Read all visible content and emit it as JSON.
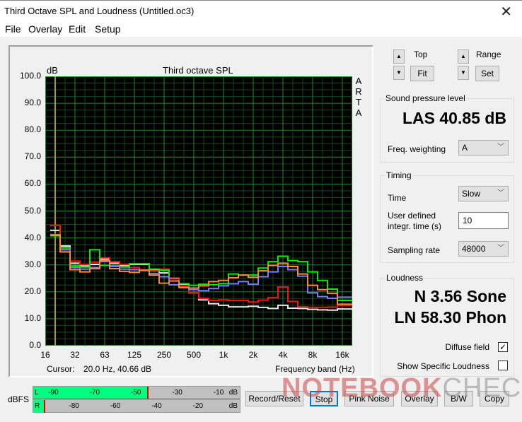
{
  "window": {
    "title": "Third Octave SPL and Loudness (Untitled.oc3)",
    "close_icon": "close-icon"
  },
  "menu": [
    "File",
    "Overlay",
    "Edit",
    "Setup"
  ],
  "plot_controls": {
    "top_label": "Top",
    "fit_label": "Fit",
    "range_label": "Range",
    "set_label": "Set",
    "up_icon": "▲",
    "down_icon": "▼"
  },
  "spl": {
    "group_label": "Sound pressure level",
    "value": "LAS 40.85 dB",
    "freq_weighting_label": "Freq. weighting",
    "freq_weighting_value": "A"
  },
  "timing": {
    "group_label": "Timing",
    "time_label": "Time",
    "time_value": "Slow",
    "integr_label_1": "User defined",
    "integr_label_2": "integr. time (s)",
    "integr_value": "10",
    "sampling_label": "Sampling rate",
    "sampling_value": "48000"
  },
  "loudness": {
    "group_label": "Loudness",
    "n_value": "N 3.56 Sone",
    "ln_value": "LN 58.30 Phon",
    "diffuse_label": "Diffuse field",
    "diffuse_checked": true,
    "specific_label": "Show Specific Loudness",
    "specific_checked": false,
    "check_glyph": "✓"
  },
  "cursor": {
    "label": "Cursor:",
    "value": "20.0 Hz, 40.66 dB"
  },
  "meter": {
    "label": "dBFS",
    "left_channel": "L",
    "right_channel": "R",
    "left_ticks": [
      "-90",
      "-70",
      "-50",
      "-30",
      "-10"
    ],
    "right_ticks": [
      "-80",
      "-60",
      "-40",
      "-20"
    ],
    "unit": "dB",
    "left_level_dbfs": -45,
    "right_level_dbfs": -95
  },
  "buttons": [
    "Record/Reset",
    "Stop",
    "Pink Noise",
    "Overlay",
    "B/W",
    "Copy"
  ],
  "watermark": {
    "text_a": "NOTEBOOK",
    "text_b": "CHECK"
  },
  "colors": {
    "plot_bg": "#000000",
    "grid_major": "#1f8a2a",
    "grid_minor": "#0e4a14",
    "cursor": "#a89a20",
    "meter_fill": "#00ff80",
    "meter_peak": "#e00000"
  },
  "chart_data": {
    "type": "line",
    "title": "Third octave SPL",
    "ylabel": "dB",
    "xlabel": "Frequency band (Hz)",
    "side_label": "ARTA",
    "ylim": [
      0,
      100
    ],
    "yticks": [
      "0.0",
      "10.0",
      "20.0",
      "30.0",
      "40.0",
      "50.0",
      "60.0",
      "70.0",
      "80.0",
      "90.0",
      "100.0"
    ],
    "xtick_labels": [
      "16",
      "32",
      "63",
      "125",
      "250",
      "500",
      "1k",
      "2k",
      "4k",
      "8k",
      "16k"
    ],
    "grid": true,
    "cursor_hz_band_index": 1,
    "bands": [
      "20",
      "25",
      "31.5",
      "40",
      "50",
      "63",
      "80",
      "100",
      "125",
      "160",
      "200",
      "250",
      "315",
      "400",
      "500",
      "630",
      "800",
      "1k",
      "1.25k",
      "1.6k",
      "2k",
      "2.5k",
      "3.15k",
      "4k",
      "5k",
      "6.3k",
      "8k",
      "10k",
      "12.5k",
      "16k",
      "20k"
    ],
    "series": [
      {
        "name": "white",
        "color": "#e8e8e8",
        "values": [
          42.8,
          37.0,
          30.6,
          29.6,
          30.2,
          32.2,
          30.6,
          29.8,
          30.2,
          30.2,
          28.2,
          27.0,
          25.0,
          22.8,
          19.6,
          17.0,
          15.6,
          15.0,
          14.4,
          14.4,
          14.6,
          14.2,
          13.8,
          15.0,
          13.9,
          13.8,
          13.5,
          13.3,
          13.2,
          13.6,
          13.6
        ]
      },
      {
        "name": "red",
        "color": "#ff1010",
        "values": [
          44.6,
          36.0,
          31.4,
          30.2,
          31.0,
          32.6,
          31.2,
          30.2,
          29.0,
          28.2,
          27.8,
          28.4,
          24.8,
          22.0,
          19.6,
          17.6,
          16.8,
          17.0,
          16.8,
          16.8,
          16.2,
          16.9,
          17.8,
          21.8,
          16.4,
          14.4,
          14.2,
          14.2,
          14.3,
          15.0,
          15.0
        ]
      },
      {
        "name": "green",
        "color": "#00ee00",
        "values": [
          40.8,
          36.4,
          29.6,
          29.2,
          35.6,
          29.8,
          29.6,
          29.2,
          30.4,
          30.4,
          28.4,
          28.0,
          24.0,
          23.0,
          22.4,
          22.8,
          22.6,
          23.0,
          26.6,
          26.2,
          26.2,
          28.8,
          31.2,
          33.2,
          31.6,
          31.2,
          27.4,
          24.2,
          21.0,
          16.8,
          16.8
        ]
      },
      {
        "name": "blue",
        "color": "#7a7aff",
        "values": [
          41.2,
          35.6,
          29.0,
          28.4,
          29.0,
          31.2,
          29.4,
          28.4,
          28.2,
          28.0,
          26.8,
          25.6,
          22.6,
          21.6,
          20.8,
          20.4,
          21.2,
          22.2,
          23.0,
          23.8,
          22.8,
          25.6,
          27.4,
          29.4,
          28.2,
          25.8,
          19.6,
          18.2,
          17.6,
          18.0,
          18.0
        ]
      },
      {
        "name": "orange",
        "color": "#ff8838",
        "values": [
          41.0,
          34.8,
          28.2,
          27.4,
          28.6,
          31.6,
          28.6,
          27.6,
          27.2,
          28.0,
          26.2,
          23.2,
          24.0,
          21.6,
          21.4,
          22.2,
          23.8,
          24.2,
          25.2,
          26.2,
          25.4,
          27.8,
          29.8,
          30.6,
          29.4,
          26.6,
          22.4,
          20.8,
          19.4,
          15.4,
          15.4
        ]
      }
    ]
  }
}
